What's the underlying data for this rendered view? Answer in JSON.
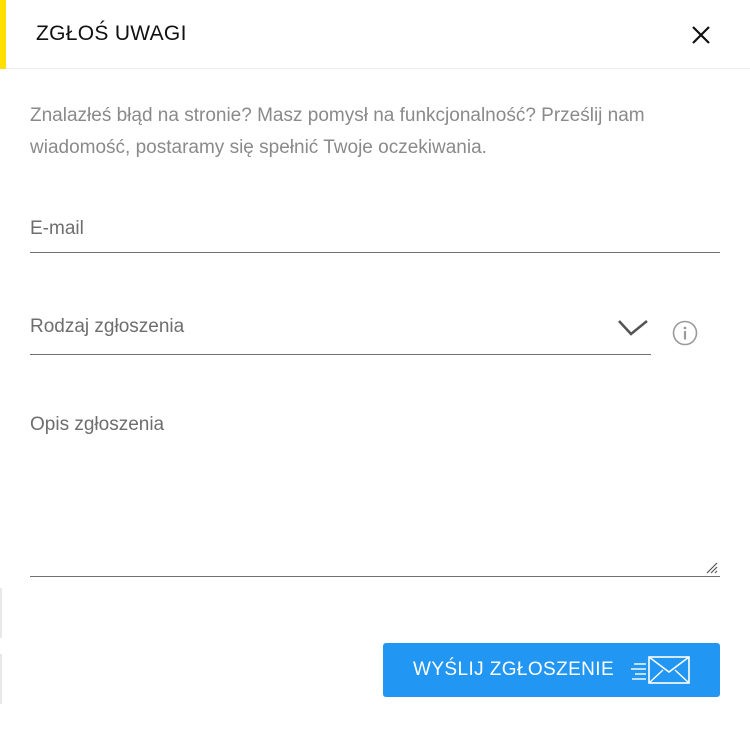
{
  "dialog": {
    "title": "ZGŁOŚ UWAGI",
    "accent_color": "#ffe000",
    "close_icon": "close-icon"
  },
  "intro_text": "Znalazłeś błąd na stronie? Masz pomysł na funkcjonalność? Prześlij nam wiadomość, postaramy się spełnić Twoje oczekiwania.",
  "form": {
    "email_placeholder": "E-mail",
    "type_placeholder": "Rodzaj zgłoszenia",
    "description_placeholder": "Opis zgłoszenia"
  },
  "submit": {
    "label": "WYŚLIJ ZGŁOSZENIE",
    "color": "#2196f3",
    "icon": "envelope-icon"
  }
}
